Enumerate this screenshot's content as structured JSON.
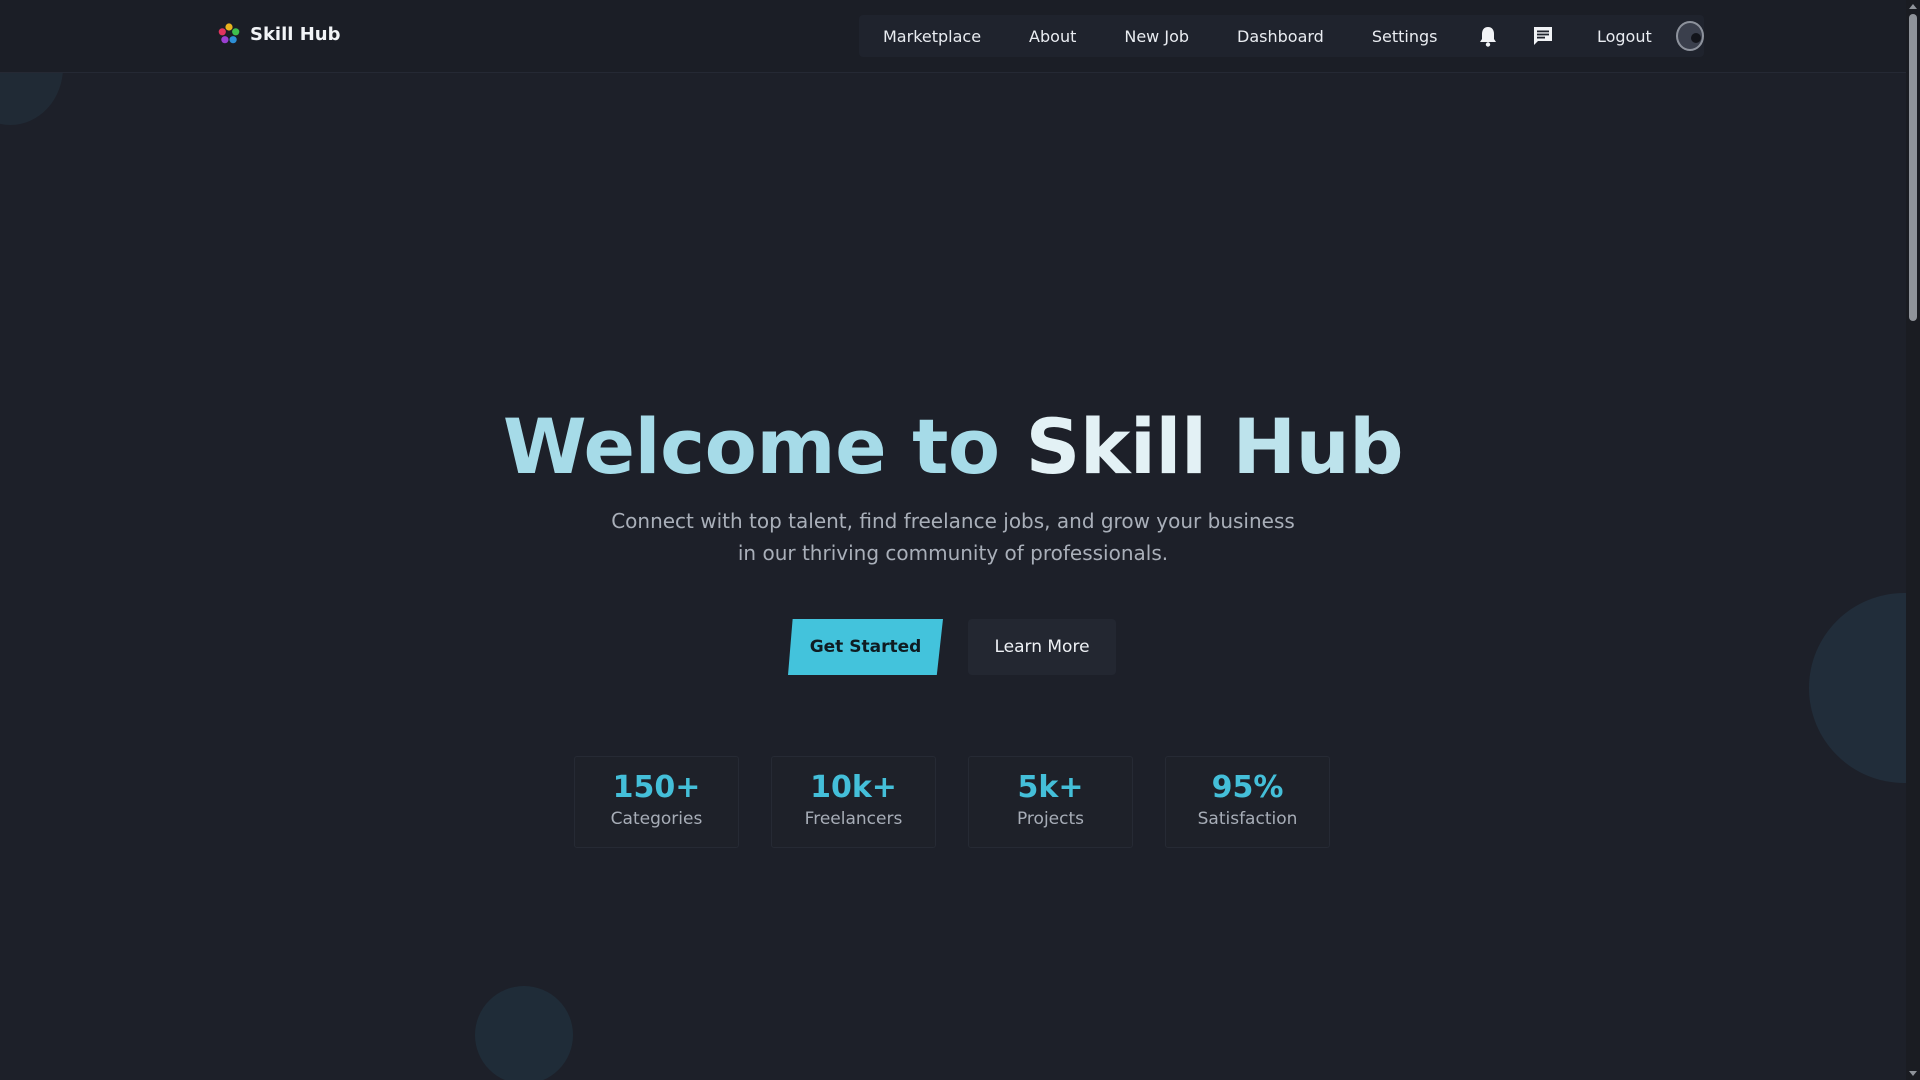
{
  "brand": {
    "name": "Skill Hub",
    "logo_icon": "colorful-flower-logo-icon"
  },
  "nav": {
    "items": [
      {
        "label": "Marketplace"
      },
      {
        "label": "About"
      },
      {
        "label": "New Job"
      },
      {
        "label": "Dashboard"
      },
      {
        "label": "Settings"
      }
    ],
    "notifications_icon": "bell-icon",
    "messages_icon": "chat-icon",
    "logout_label": "Logout",
    "avatar_icon": "user-avatar"
  },
  "hero": {
    "title_part1": "Welcome to ",
    "title_part2": "Skill ",
    "title_part3": "Hub",
    "subtitle": "Connect with top talent, find freelance jobs, and grow your business in our thriving community of professionals.",
    "primary_button": "Get Started",
    "secondary_button": "Learn More"
  },
  "stats": [
    {
      "value": "150+",
      "label": "Categories"
    },
    {
      "value": "10k+",
      "label": "Freelancers"
    },
    {
      "value": "5k+",
      "label": "Projects"
    },
    {
      "value": "95%",
      "label": "Satisfaction"
    }
  ],
  "colors": {
    "background": "#1d2029",
    "accent": "#43c3dc",
    "title": "#a6dbe8",
    "muted_text": "#a9afb9"
  }
}
